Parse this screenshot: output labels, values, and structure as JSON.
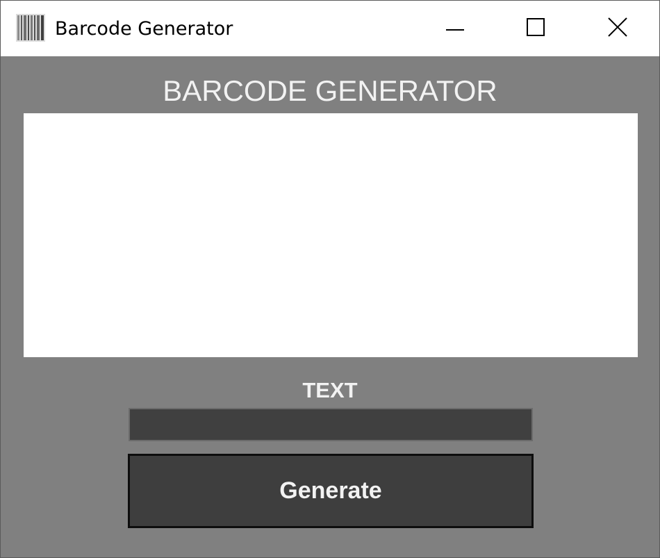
{
  "window": {
    "title": "Barcode Generator",
    "icon": "barcode-icon",
    "controls": {
      "minimize": "minimize-icon",
      "maximize": "maximize-icon",
      "close": "close-icon"
    }
  },
  "main": {
    "heading": "BARCODE GENERATOR",
    "text_label": "TEXT",
    "text_value": "",
    "generate_label": "Generate"
  },
  "colors": {
    "background": "#808080",
    "input_background": "#404040",
    "button_background": "#3e3e3e",
    "text": "#f2f2f2"
  }
}
